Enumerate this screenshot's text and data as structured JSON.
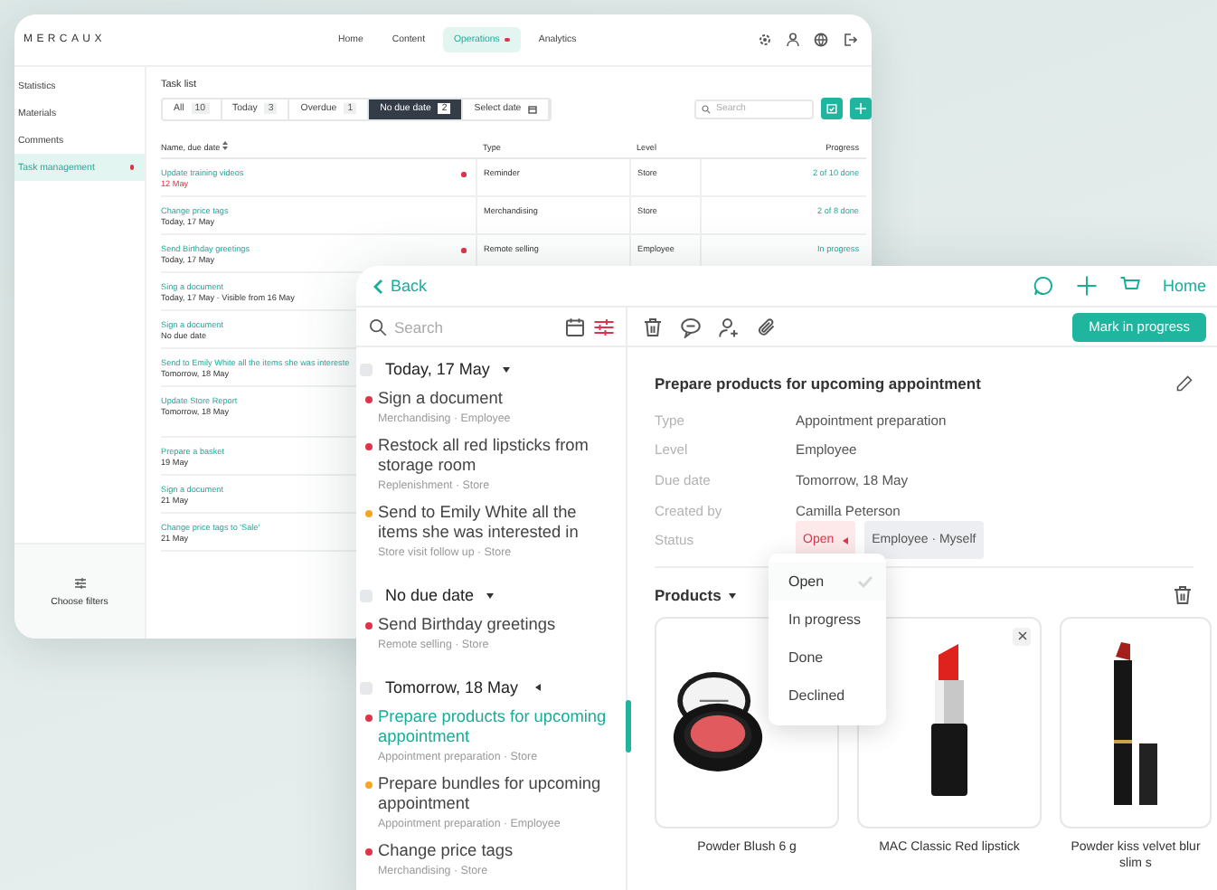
{
  "back_window": {
    "logo": "MERCAUX",
    "nav": [
      {
        "label": "Home",
        "selected": false,
        "badge": false
      },
      {
        "label": "Content",
        "selected": false,
        "badge": false
      },
      {
        "label": "Operations",
        "selected": true,
        "badge": true
      },
      {
        "label": "Analytics",
        "selected": false,
        "badge": false
      }
    ],
    "sidebar": {
      "items": [
        {
          "label": "Statistics",
          "selected": false,
          "badge": false
        },
        {
          "label": "Materials",
          "selected": false,
          "badge": false
        },
        {
          "label": "Comments",
          "selected": false,
          "badge": false
        },
        {
          "label": "Task management",
          "selected": true,
          "badge": true
        }
      ],
      "filters_button": "Choose filters"
    },
    "task_list": {
      "title": "Task list",
      "filters": [
        {
          "label": "All",
          "count": "10",
          "selected": false
        },
        {
          "label": "Today",
          "count": "3",
          "selected": false
        },
        {
          "label": "Overdue",
          "count": "1",
          "selected": false
        },
        {
          "label": "No due date",
          "count": "2",
          "selected": true
        },
        {
          "label": "Select date",
          "selected": false
        }
      ],
      "search": {
        "placeholder": "Search"
      },
      "columns": [
        "Name, due date",
        "Type",
        "Level",
        "Progress"
      ],
      "rows": [
        {
          "name": "Update training videos",
          "due": "12 May",
          "overdue": true,
          "flag": true,
          "type": "Reminder",
          "level": "Store",
          "progress": "2 of 10 done"
        },
        {
          "name": "Change price tags",
          "due": "Today, 17 May",
          "overdue": false,
          "flag": false,
          "type": "Merchandising",
          "level": "Store",
          "progress": "2 of 8 done"
        },
        {
          "name": "Send Birthday greetings",
          "due": "Today, 17 May",
          "overdue": false,
          "flag": true,
          "type": "Remote selling",
          "level": "Employee",
          "progress": "In progress"
        },
        {
          "name": "Sing a document",
          "due": "Today, 17 May · Visible from 16 May",
          "overdue": false,
          "flag": false
        },
        {
          "name": "Sign a document",
          "due": "No due date",
          "overdue": false,
          "flag": false
        },
        {
          "name": "Send to Emily White all the items she was intereste",
          "due": "Tomorrow, 18 May",
          "overdue": false,
          "flag": false
        },
        {
          "name": "Update Store Report",
          "due": "Tomorrow, 18 May",
          "overdue": false,
          "flag": false
        },
        {
          "name": "Prepare a basket",
          "due": "19 May",
          "overdue": false,
          "flag": false
        },
        {
          "name": "Sign a document",
          "due": "21 May",
          "overdue": false,
          "flag": false
        },
        {
          "name": "Change price tags to 'Sale'",
          "due": "21 May",
          "overdue": false,
          "flag": false
        }
      ]
    }
  },
  "front_window": {
    "back": "Back",
    "home": "Home",
    "search": {
      "placeholder": "Search"
    },
    "action": "Mark in progress",
    "groups": [
      {
        "label": "Today, 17 May",
        "expanded": true,
        "checked": false,
        "items": [
          {
            "title": "Sign a document",
            "meta": "Merchandising · Employee",
            "color": "#e0334a",
            "selected": false
          },
          {
            "title": "Restock all red lipsticks from storage room",
            "meta": "Replenishment · Store",
            "color": "#e0334a",
            "selected": false
          },
          {
            "title": "Send to Emily White all the items she was interested in",
            "meta": "Store visit follow up · Store",
            "color": "#f5a623",
            "selected": false
          }
        ]
      },
      {
        "label": "No due date",
        "expanded": true,
        "checked": false,
        "items": [
          {
            "title": "Send Birthday greetings",
            "meta": "Remote selling · Store",
            "color": "#e0334a",
            "selected": false
          }
        ]
      },
      {
        "label": "Tomorrow, 18 May",
        "expanded": false,
        "checked": false,
        "items": [
          {
            "title": "Prepare products for upcoming appointment",
            "meta": "Appointment preparation · Store",
            "color": "#e0334a",
            "selected": true
          },
          {
            "title": "Prepare bundles for upcoming appointment",
            "meta": "Appointment preparation · Employee",
            "color": "#f5a623",
            "selected": false
          },
          {
            "title": "Change price tags",
            "meta": "Merchandising · Store",
            "color": "#e0334a",
            "selected": false
          }
        ]
      }
    ],
    "detail": {
      "title": "Prepare products for upcoming appointment",
      "fields": [
        {
          "label": "Type",
          "value": "Appointment preparation"
        },
        {
          "label": "Level",
          "value": "Employee"
        },
        {
          "label": "Due date",
          "value": "Tomorrow, 18 May"
        },
        {
          "label": "Created by",
          "value": "Camilla Peterson"
        }
      ],
      "status": {
        "label": "Status",
        "value": "Open",
        "menu_open": true
      },
      "tag": "Employee · Myself",
      "status_menu": [
        {
          "label": "Open",
          "selected": true
        },
        {
          "label": "In progress",
          "selected": false
        },
        {
          "label": "Done",
          "selected": false
        },
        {
          "label": "Declined",
          "selected": false
        }
      ],
      "products_label": "Products",
      "products": [
        {
          "name": "Powder Blush 6 g",
          "kind": "compact",
          "removable": false
        },
        {
          "name": "MAC Classic Red lipstick",
          "kind": "lipstick",
          "removable": true
        },
        {
          "name": "Powder kiss velvet blur slim s",
          "kind": "slim",
          "removable": false
        }
      ]
    }
  }
}
